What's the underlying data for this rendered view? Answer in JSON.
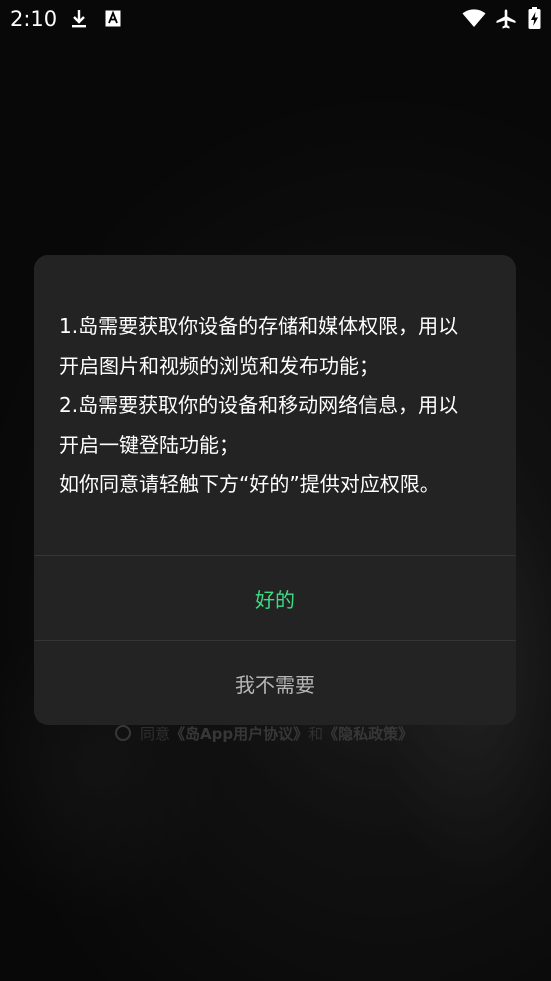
{
  "status_bar": {
    "time": "2:10",
    "icons": [
      "download-icon",
      "keyboard-a-icon",
      "wifi-icon",
      "airplane-icon",
      "battery-charging-icon"
    ]
  },
  "background": {
    "agreement": {
      "prefix": "同意",
      "user_agreement": "《岛App用户协议》",
      "and": "和",
      "privacy_policy": "《隐私政策》"
    }
  },
  "dialog": {
    "lines": [
      "1.岛需要获取你设备的存储和媒体权限，用以",
      "开启图片和视频的浏览和发布功能；",
      "2.岛需要获取你的设备和移动网络信息，用以",
      "开启一键登陆功能；",
      "如你同意请轻触下方“好的”提供对应权限。"
    ],
    "ok_label": "好的",
    "decline_label": "我不需要"
  },
  "colors": {
    "accent": "#3ddc84",
    "dialog_bg": "#232323",
    "text": "#ffffff",
    "secondary_text": "#b5b5b5"
  }
}
